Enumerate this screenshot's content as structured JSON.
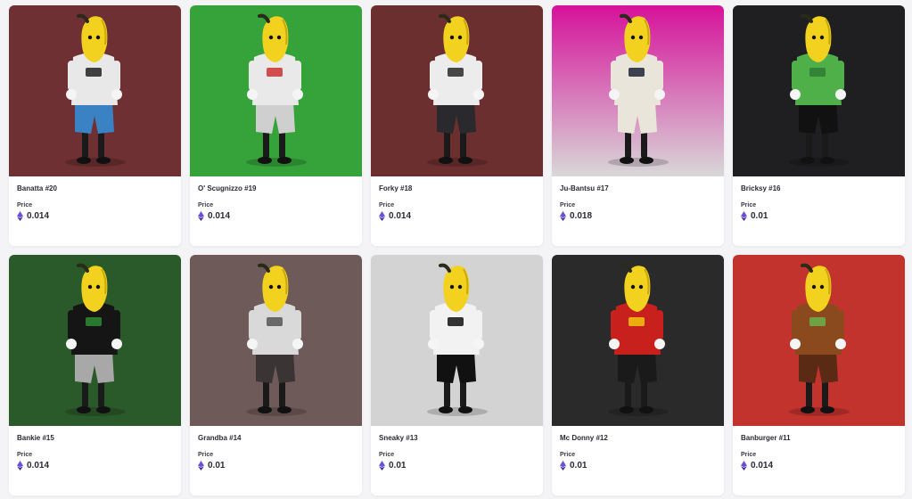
{
  "price_label": "Price",
  "items": [
    {
      "name": "Banatta #20",
      "price": "0.014",
      "bg": "#6e3032",
      "bg2": "#6e3032",
      "top": "#e8e8e8",
      "bottom": "#3b82c4",
      "accent": "#222"
    },
    {
      "name": "O' Scugnizzo #19",
      "price": "0.014",
      "bg": "#35a23a",
      "bg2": "#35a23a",
      "top": "#e9e9e9",
      "bottom": "#cfcfcf",
      "accent": "#c33"
    },
    {
      "name": "Forky #18",
      "price": "0.014",
      "bg": "#6c2f30",
      "bg2": "#6c2f30",
      "top": "#ececec",
      "bottom": "#2a2a2e",
      "accent": "#2a2a2e"
    },
    {
      "name": "Ju-Bantsu #17",
      "price": "0.018",
      "bg": "#d6119a",
      "bg2": "#d8d8d8",
      "top": "#e9e5da",
      "bottom": "#e9e5da",
      "accent": "#1f2336"
    },
    {
      "name": "Bricksy #16",
      "price": "0.01",
      "bg": "#1f1f21",
      "bg2": "#1f1f21",
      "top": "#4fb04a",
      "bottom": "#111",
      "accent": "#2e7d32"
    },
    {
      "name": "Bankie #15",
      "price": "0.014",
      "bg": "#2b5a2a",
      "bg2": "#2b5a2a",
      "top": "#151515",
      "bottom": "#a8a8a8",
      "accent": "#2d8b34"
    },
    {
      "name": "Grandba #14",
      "price": "0.01",
      "bg": "#6f5a5a",
      "bg2": "#6f5a5a",
      "top": "#d9d9d9",
      "bottom": "#3a3434",
      "accent": "#555"
    },
    {
      "name": "Sneaky #13",
      "price": "0.01",
      "bg": "#d3d3d3",
      "bg2": "#d3d3d3",
      "top": "#f2f2f2",
      "bottom": "#111",
      "accent": "#111"
    },
    {
      "name": "Mc Donny #12",
      "price": "0.01",
      "bg": "#2a2a2b",
      "bg2": "#2a2a2b",
      "top": "#c8201c",
      "bottom": "#1a1a1a",
      "accent": "#f1c40f"
    },
    {
      "name": "Banburger #11",
      "price": "0.014",
      "bg": "#c3332d",
      "bg2": "#c3332d",
      "top": "#8a4a1e",
      "bottom": "#5a2a14",
      "accent": "#6ab04c"
    }
  ],
  "colors": {
    "eth": "#6b4fd8",
    "eth_dark": "#3d2a9e"
  }
}
